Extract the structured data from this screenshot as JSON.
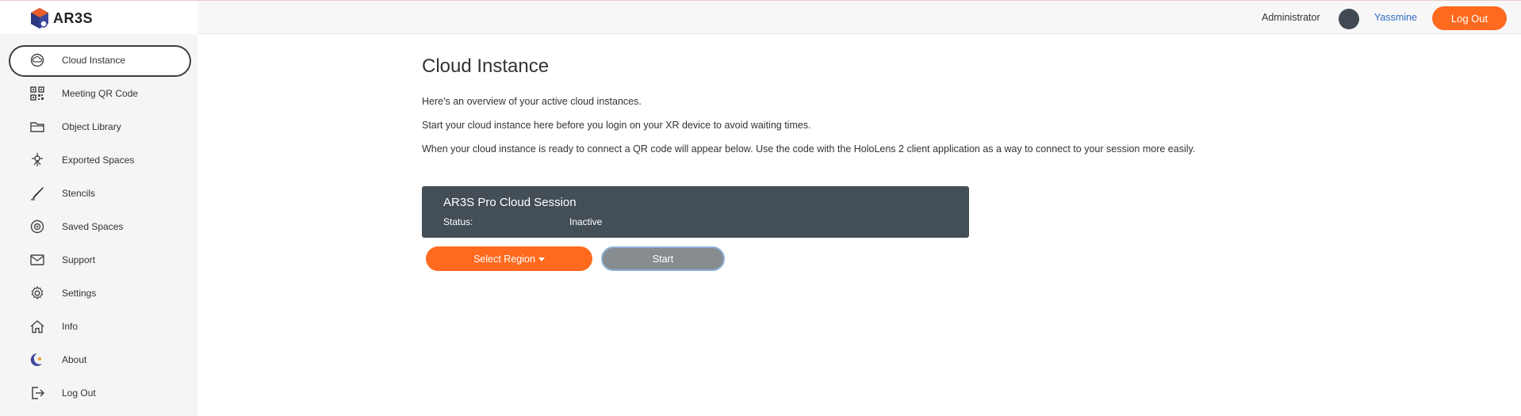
{
  "brand": {
    "name": "AR3S"
  },
  "sidebar": {
    "items": [
      {
        "label": "Cloud Instance",
        "icon": "cloud-instance-icon",
        "active": true
      },
      {
        "label": "Meeting QR Code",
        "icon": "qr-code-icon"
      },
      {
        "label": "Object Library",
        "icon": "folder-icon"
      },
      {
        "label": "Exported Spaces",
        "icon": "exported-spaces-icon"
      },
      {
        "label": "Stencils",
        "icon": "pen-icon"
      },
      {
        "label": "Saved Spaces",
        "icon": "saved-spaces-icon"
      },
      {
        "label": "Support",
        "icon": "mail-icon"
      },
      {
        "label": "Settings",
        "icon": "gear-icon"
      },
      {
        "label": "Info",
        "icon": "home-icon"
      },
      {
        "label": "About",
        "icon": "about-icon"
      },
      {
        "label": "Log Out",
        "icon": "logout-icon"
      }
    ]
  },
  "header": {
    "role": "Administrator",
    "username": "Yassmine",
    "logout_label": "Log Out"
  },
  "main": {
    "title": "Cloud Instance",
    "intro": [
      "Here's an overview of your active cloud instances.",
      "Start your cloud instance here before you login on your XR device to avoid waiting times.",
      "When your cloud instance is ready to connect a QR code will appear below. Use the code with the HoloLens 2 client application as a way to connect to your session more easily."
    ],
    "session": {
      "title": "AR3S Pro Cloud Session",
      "status_label": "Status:",
      "status_value": "Inactive"
    },
    "region_button": "Select Region",
    "start_button": "Start"
  },
  "colors": {
    "accent": "#ff6a1f",
    "card": "#434e56",
    "link": "#2f6ec6",
    "start_button": "#878c90"
  }
}
